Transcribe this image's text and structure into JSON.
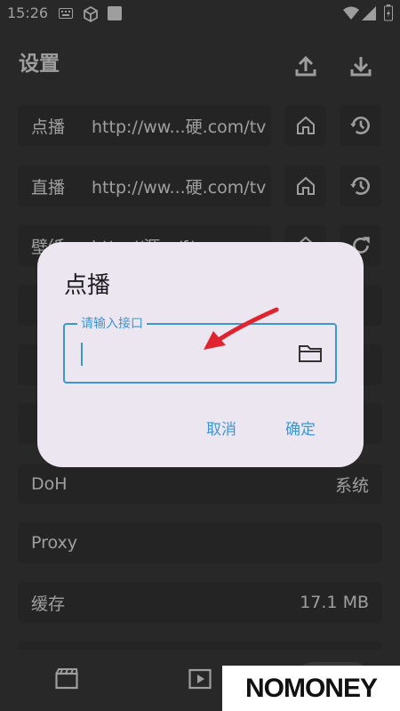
{
  "status": {
    "time": "15:26"
  },
  "header": {
    "title": "设置"
  },
  "rows": [
    {
      "label": "点播",
      "value": "http://ww...硬.com/tv"
    },
    {
      "label": "直播",
      "value": "http://ww...硬.com/tv"
    },
    {
      "label": "壁纸",
      "value": "http://源.../f/"
    },
    {
      "label": "",
      "value": ""
    },
    {
      "label": "",
      "value": ""
    },
    {
      "label": "",
      "value": ""
    },
    {
      "label": "DoH",
      "value": "系统"
    },
    {
      "label": "Proxy",
      "value": ""
    },
    {
      "label": "缓存",
      "value": "17.1 MB"
    }
  ],
  "dialog": {
    "title": "点播",
    "field_label": "请输入接口",
    "cancel": "取消",
    "confirm": "确定"
  },
  "watermark": {
    "text": "NOMONEY"
  },
  "colors": {
    "accent": "#3d96d4",
    "dialog_bg": "#ece6f0",
    "arrow": "#e0242f"
  }
}
